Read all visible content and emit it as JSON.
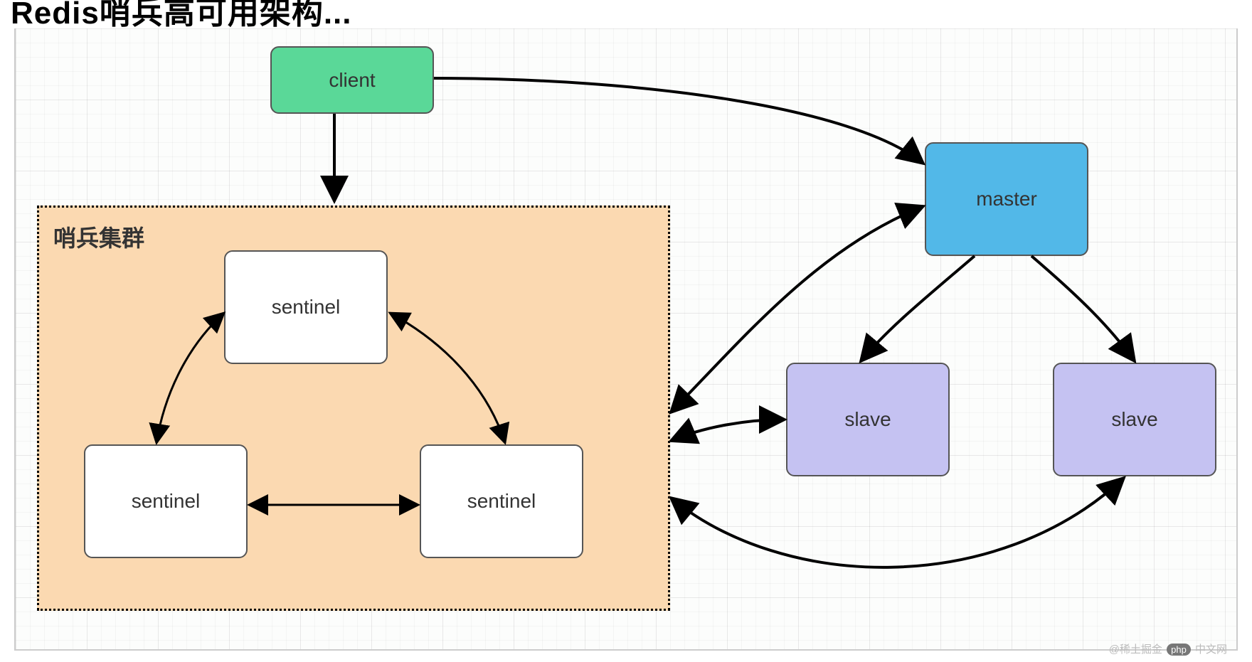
{
  "title_partial": "Redis哨兵高可用架构...",
  "nodes": {
    "client": {
      "label": "client"
    },
    "master": {
      "label": "master"
    },
    "slave1": {
      "label": "slave"
    },
    "slave2": {
      "label": "slave"
    },
    "sentinel1": {
      "label": "sentinel"
    },
    "sentinel2": {
      "label": "sentinel"
    },
    "sentinel3": {
      "label": "sentinel"
    }
  },
  "cluster": {
    "label": "哨兵集群"
  },
  "colors": {
    "client": "#5ad898",
    "master": "#52b8e8",
    "slave": "#c5c2f2",
    "cluster_bg": "#fbd9b1",
    "sentinel": "#ffffff"
  },
  "connections": [
    {
      "from": "client",
      "to": "cluster",
      "type": "arrow",
      "desc": "client → sentinel cluster"
    },
    {
      "from": "client",
      "to": "master",
      "type": "arrow",
      "desc": "client → master"
    },
    {
      "from": "cluster",
      "to": "master",
      "type": "biarrow",
      "desc": "sentinel cluster ↔ master"
    },
    {
      "from": "cluster",
      "to": "slave1",
      "type": "biarrow",
      "desc": "sentinel cluster ↔ slave (left)"
    },
    {
      "from": "cluster",
      "to": "slave2",
      "type": "biarrow",
      "desc": "sentinel cluster ↔ slave (right)"
    },
    {
      "from": "master",
      "to": "slave1",
      "type": "arrow",
      "desc": "master → slave (left)"
    },
    {
      "from": "master",
      "to": "slave2",
      "type": "arrow",
      "desc": "master → slave (right)"
    },
    {
      "from": "sentinel1",
      "to": "sentinel2",
      "type": "biarrow",
      "desc": "sentinel ↔ sentinel"
    },
    {
      "from": "sentinel1",
      "to": "sentinel3",
      "type": "biarrow",
      "desc": "sentinel ↔ sentinel"
    },
    {
      "from": "sentinel2",
      "to": "sentinel3",
      "type": "biarrow",
      "desc": "sentinel ↔ sentinel"
    }
  ],
  "watermark": {
    "prefix": "@稀土掘金",
    "badge": "php",
    "suffix": "中文网"
  }
}
